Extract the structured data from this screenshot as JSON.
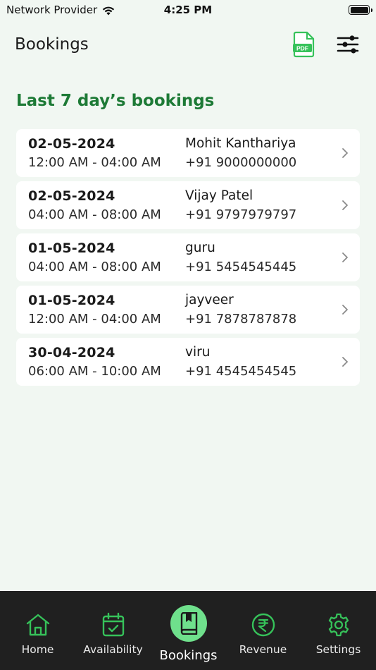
{
  "status_bar": {
    "carrier": "Network Provider",
    "time": "4:25 PM",
    "wifi_icon": "wifi-icon",
    "battery_icon": "battery-icon"
  },
  "header": {
    "title": "Bookings",
    "pdf_icon": "pdf-file-icon",
    "pdf_icon_text": "PDF",
    "filter_icon": "sliders-icon"
  },
  "section": {
    "title": "Last 7 day’s bookings"
  },
  "bookings": [
    {
      "date": "02-05-2024",
      "time": "12:00 AM - 04:00 AM",
      "name": "Mohit Kanthariya",
      "phone": "+91 9000000000"
    },
    {
      "date": "02-05-2024",
      "time": "04:00 AM - 08:00 AM",
      "name": "Vijay Patel",
      "phone": "+91 9797979797"
    },
    {
      "date": "01-05-2024",
      "time": "04:00 AM - 08:00 AM",
      "name": "guru",
      "phone": "+91 5454545445"
    },
    {
      "date": "01-05-2024",
      "time": "12:00 AM - 04:00 AM",
      "name": "jayveer",
      "phone": "+91 7878787878"
    },
    {
      "date": "30-04-2024",
      "time": "06:00 AM - 10:00 AM",
      "name": "viru",
      "phone": "+91 4545454545"
    }
  ],
  "tabs": [
    {
      "label": "Home",
      "icon": "home-icon",
      "active": false
    },
    {
      "label": "Availability",
      "icon": "calendar-check-icon",
      "active": false
    },
    {
      "label": "Bookings",
      "icon": "booking-book-icon",
      "active": true
    },
    {
      "label": "Revenue",
      "icon": "rupee-icon",
      "active": false
    },
    {
      "label": "Settings",
      "icon": "gear-icon",
      "active": false
    }
  ],
  "colors": {
    "background": "#f1f7f2",
    "accent_green": "#1d7a36",
    "icon_green": "#36c25a",
    "active_tab_bg": "#6fe08c",
    "tab_bar_bg": "#202020"
  }
}
